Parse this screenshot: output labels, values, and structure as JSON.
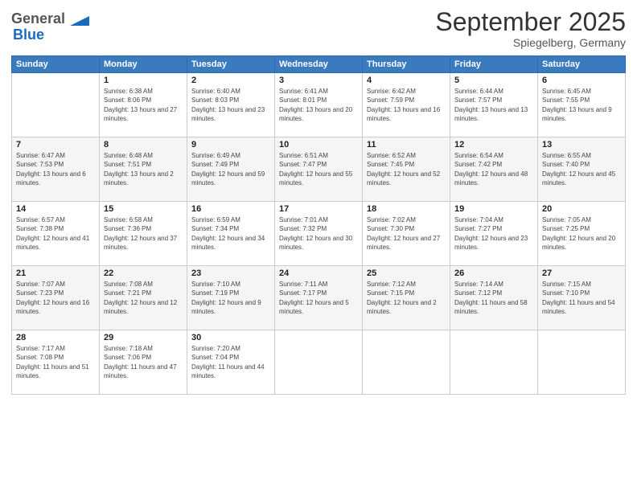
{
  "header": {
    "logo_general": "General",
    "logo_blue": "Blue",
    "month_title": "September 2025",
    "location": "Spiegelberg, Germany"
  },
  "weekdays": [
    "Sunday",
    "Monday",
    "Tuesday",
    "Wednesday",
    "Thursday",
    "Friday",
    "Saturday"
  ],
  "weeks": [
    [
      {
        "day": "",
        "sunrise": "",
        "sunset": "",
        "daylight": ""
      },
      {
        "day": "1",
        "sunrise": "Sunrise: 6:38 AM",
        "sunset": "Sunset: 8:06 PM",
        "daylight": "Daylight: 13 hours and 27 minutes."
      },
      {
        "day": "2",
        "sunrise": "Sunrise: 6:40 AM",
        "sunset": "Sunset: 8:03 PM",
        "daylight": "Daylight: 13 hours and 23 minutes."
      },
      {
        "day": "3",
        "sunrise": "Sunrise: 6:41 AM",
        "sunset": "Sunset: 8:01 PM",
        "daylight": "Daylight: 13 hours and 20 minutes."
      },
      {
        "day": "4",
        "sunrise": "Sunrise: 6:42 AM",
        "sunset": "Sunset: 7:59 PM",
        "daylight": "Daylight: 13 hours and 16 minutes."
      },
      {
        "day": "5",
        "sunrise": "Sunrise: 6:44 AM",
        "sunset": "Sunset: 7:57 PM",
        "daylight": "Daylight: 13 hours and 13 minutes."
      },
      {
        "day": "6",
        "sunrise": "Sunrise: 6:45 AM",
        "sunset": "Sunset: 7:55 PM",
        "daylight": "Daylight: 13 hours and 9 minutes."
      }
    ],
    [
      {
        "day": "7",
        "sunrise": "Sunrise: 6:47 AM",
        "sunset": "Sunset: 7:53 PM",
        "daylight": "Daylight: 13 hours and 6 minutes."
      },
      {
        "day": "8",
        "sunrise": "Sunrise: 6:48 AM",
        "sunset": "Sunset: 7:51 PM",
        "daylight": "Daylight: 13 hours and 2 minutes."
      },
      {
        "day": "9",
        "sunrise": "Sunrise: 6:49 AM",
        "sunset": "Sunset: 7:49 PM",
        "daylight": "Daylight: 12 hours and 59 minutes."
      },
      {
        "day": "10",
        "sunrise": "Sunrise: 6:51 AM",
        "sunset": "Sunset: 7:47 PM",
        "daylight": "Daylight: 12 hours and 55 minutes."
      },
      {
        "day": "11",
        "sunrise": "Sunrise: 6:52 AM",
        "sunset": "Sunset: 7:45 PM",
        "daylight": "Daylight: 12 hours and 52 minutes."
      },
      {
        "day": "12",
        "sunrise": "Sunrise: 6:54 AM",
        "sunset": "Sunset: 7:42 PM",
        "daylight": "Daylight: 12 hours and 48 minutes."
      },
      {
        "day": "13",
        "sunrise": "Sunrise: 6:55 AM",
        "sunset": "Sunset: 7:40 PM",
        "daylight": "Daylight: 12 hours and 45 minutes."
      }
    ],
    [
      {
        "day": "14",
        "sunrise": "Sunrise: 6:57 AM",
        "sunset": "Sunset: 7:38 PM",
        "daylight": "Daylight: 12 hours and 41 minutes."
      },
      {
        "day": "15",
        "sunrise": "Sunrise: 6:58 AM",
        "sunset": "Sunset: 7:36 PM",
        "daylight": "Daylight: 12 hours and 37 minutes."
      },
      {
        "day": "16",
        "sunrise": "Sunrise: 6:59 AM",
        "sunset": "Sunset: 7:34 PM",
        "daylight": "Daylight: 12 hours and 34 minutes."
      },
      {
        "day": "17",
        "sunrise": "Sunrise: 7:01 AM",
        "sunset": "Sunset: 7:32 PM",
        "daylight": "Daylight: 12 hours and 30 minutes."
      },
      {
        "day": "18",
        "sunrise": "Sunrise: 7:02 AM",
        "sunset": "Sunset: 7:30 PM",
        "daylight": "Daylight: 12 hours and 27 minutes."
      },
      {
        "day": "19",
        "sunrise": "Sunrise: 7:04 AM",
        "sunset": "Sunset: 7:27 PM",
        "daylight": "Daylight: 12 hours and 23 minutes."
      },
      {
        "day": "20",
        "sunrise": "Sunrise: 7:05 AM",
        "sunset": "Sunset: 7:25 PM",
        "daylight": "Daylight: 12 hours and 20 minutes."
      }
    ],
    [
      {
        "day": "21",
        "sunrise": "Sunrise: 7:07 AM",
        "sunset": "Sunset: 7:23 PM",
        "daylight": "Daylight: 12 hours and 16 minutes."
      },
      {
        "day": "22",
        "sunrise": "Sunrise: 7:08 AM",
        "sunset": "Sunset: 7:21 PM",
        "daylight": "Daylight: 12 hours and 12 minutes."
      },
      {
        "day": "23",
        "sunrise": "Sunrise: 7:10 AM",
        "sunset": "Sunset: 7:19 PM",
        "daylight": "Daylight: 12 hours and 9 minutes."
      },
      {
        "day": "24",
        "sunrise": "Sunrise: 7:11 AM",
        "sunset": "Sunset: 7:17 PM",
        "daylight": "Daylight: 12 hours and 5 minutes."
      },
      {
        "day": "25",
        "sunrise": "Sunrise: 7:12 AM",
        "sunset": "Sunset: 7:15 PM",
        "daylight": "Daylight: 12 hours and 2 minutes."
      },
      {
        "day": "26",
        "sunrise": "Sunrise: 7:14 AM",
        "sunset": "Sunset: 7:12 PM",
        "daylight": "Daylight: 11 hours and 58 minutes."
      },
      {
        "day": "27",
        "sunrise": "Sunrise: 7:15 AM",
        "sunset": "Sunset: 7:10 PM",
        "daylight": "Daylight: 11 hours and 54 minutes."
      }
    ],
    [
      {
        "day": "28",
        "sunrise": "Sunrise: 7:17 AM",
        "sunset": "Sunset: 7:08 PM",
        "daylight": "Daylight: 11 hours and 51 minutes."
      },
      {
        "day": "29",
        "sunrise": "Sunrise: 7:18 AM",
        "sunset": "Sunset: 7:06 PM",
        "daylight": "Daylight: 11 hours and 47 minutes."
      },
      {
        "day": "30",
        "sunrise": "Sunrise: 7:20 AM",
        "sunset": "Sunset: 7:04 PM",
        "daylight": "Daylight: 11 hours and 44 minutes."
      },
      {
        "day": "",
        "sunrise": "",
        "sunset": "",
        "daylight": ""
      },
      {
        "day": "",
        "sunrise": "",
        "sunset": "",
        "daylight": ""
      },
      {
        "day": "",
        "sunrise": "",
        "sunset": "",
        "daylight": ""
      },
      {
        "day": "",
        "sunrise": "",
        "sunset": "",
        "daylight": ""
      }
    ]
  ]
}
